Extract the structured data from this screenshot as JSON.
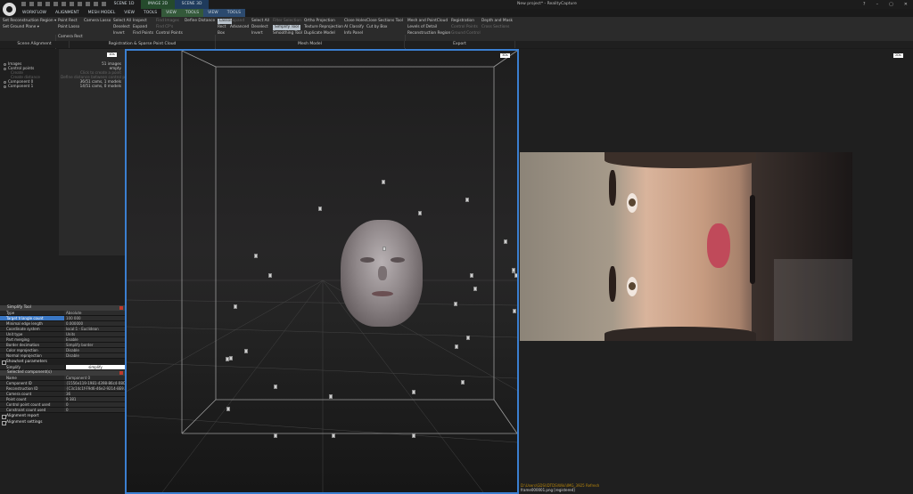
{
  "window": {
    "title": "New project* - RealityCapture",
    "controls": [
      "?",
      "–",
      "▢",
      "✕"
    ]
  },
  "doc_tabs": [
    {
      "label": "SCENE 1D",
      "color": "#1c1c1c"
    },
    {
      "label": "IMAGE 2D",
      "color": "#254a2c"
    },
    {
      "label": "SCENE 3D",
      "color": "#1f3b5c"
    }
  ],
  "menu_tabs": [
    {
      "label": "WORKFLOW",
      "color": "#1c1c1c"
    },
    {
      "label": "ALIGNMENT",
      "color": "#1c1c1c"
    },
    {
      "label": "MESH MODEL",
      "color": "#1c1c1c"
    },
    {
      "label": "VIEW",
      "color": "#1c1c1c"
    },
    {
      "label": "TOOLS",
      "color": "#1c1c1c"
    },
    {
      "label": "VIEW",
      "color": "#34593a"
    },
    {
      "label": "TOOLS",
      "color": "#34593a"
    },
    {
      "label": "VIEW",
      "color": "#2c4a6e"
    },
    {
      "label": "TOOLS",
      "color": "#2c4a6e"
    }
  ],
  "ribbon": {
    "c1": [
      "Set Reconstruction Region ▾",
      "Set Ground Plane ▾"
    ],
    "c2": [
      "Point Rect",
      "Point Lasso",
      "Camera Rect"
    ],
    "c3": [
      "Camera Lasso"
    ],
    "c4": [
      "Select All",
      "Deselect",
      "Invert"
    ],
    "c5": [
      "Inspect",
      "Expand",
      "Find Points"
    ],
    "c6": [
      "Find Images",
      "Find CP's",
      "Control Points"
    ],
    "c7": [
      "Define Distance"
    ],
    "c8": [
      "Lasso",
      "Rect",
      "Box"
    ],
    "c9": [
      "Expand",
      "Advanced"
    ],
    "c10": [
      "Select All",
      "Deselect",
      "Invert"
    ],
    "c11": [
      "Filter Selection",
      "Simplify Tool",
      "Smoothing Tool"
    ],
    "c12": [
      "Ortho Projection",
      "Texture Reprojection",
      "Duplicate Model"
    ],
    "c13": [
      "Close Holes",
      "AI Classify",
      "Info Panel"
    ],
    "c14": [
      "Close Sections Tool",
      "Cut by Box"
    ],
    "c15": [
      "Mesh and PointCloud",
      "Levels of Detail",
      "Reconstruction Region"
    ],
    "c16": [
      "Registration",
      "Control Points",
      "Ground Control"
    ],
    "c17": [
      "Depth and Mask",
      "Cross Sections"
    ]
  },
  "groups": [
    {
      "label": "Scene Alignment"
    },
    {
      "label": "Registration & Sparse Point Cloud"
    },
    {
      "label": "Mesh Model"
    },
    {
      "label": "Export"
    }
  ],
  "tree": [
    {
      "label": "Images",
      "value": "51 images",
      "dim": false
    },
    {
      "label": "Control points",
      "value": "empty",
      "dim": false
    },
    {
      "label": "Create",
      "value": "Click to create a point",
      "dim": true
    },
    {
      "label": "Create distance",
      "value": "Define distance between control points",
      "dim": true
    },
    {
      "label": "Component 0",
      "value": "36/51 cams, 1 models",
      "dim": false
    },
    {
      "label": "Component 1",
      "value": "14/51 cams, 0 models",
      "dim": false
    }
  ],
  "view_buttons": {
    "left_pane": "1Ds",
    "viewport": "3Ds",
    "right_pane": "2Ds"
  },
  "simplify_panel": {
    "title": "Simplify Tool",
    "rows": [
      {
        "k": "Type",
        "v": "Absolute",
        "sel": false
      },
      {
        "k": "Target triangle count",
        "v": "100 000",
        "sel": true
      },
      {
        "k": "Minimal edge length",
        "v": "0.000000",
        "sel": false
      },
      {
        "k": "Coordinate system",
        "v": "local:1 - Euclidean",
        "sel": false
      },
      {
        "k": "Unit type",
        "v": "Units",
        "sel": false
      },
      {
        "k": "Part merging",
        "v": "Enable",
        "sel": false
      },
      {
        "k": "Border decimation",
        "v": "Simplify border",
        "sel": false
      },
      {
        "k": "Color reprojection",
        "v": "Disable",
        "sel": false
      },
      {
        "k": "Normal reprojection",
        "v": "Disable",
        "sel": false
      }
    ],
    "advanced_label": "Show/set parameters",
    "simplify_label": "Simplify",
    "simplify_button": "simplify"
  },
  "component_panel": {
    "title": "Selected component(s)",
    "rows": [
      {
        "k": "Name",
        "v": "Component 0"
      },
      {
        "k": "Component ID",
        "v": "{1556e119-1981-4398-86c4-08C..."
      },
      {
        "k": "Reconstruction ID",
        "v": "{C3c14c1f-F9d6-46e2-9214-8E9..."
      },
      {
        "k": "Camera count",
        "v": "36"
      },
      {
        "k": "Point count",
        "v": "9 381"
      },
      {
        "k": "Control point count used",
        "v": "0"
      },
      {
        "k": "Constraint count used",
        "v": "0"
      }
    ]
  },
  "sections": [
    {
      "label": "Alignment report"
    },
    {
      "label": "Alignment settings"
    }
  ],
  "console": [
    {
      "text": "D:\\Users\\GDS\\IDTDS\\Wiki\\IMG_3925 Refresh",
      "ok": false
    },
    {
      "text": "frame000001.png [registered]",
      "ok": true
    }
  ]
}
